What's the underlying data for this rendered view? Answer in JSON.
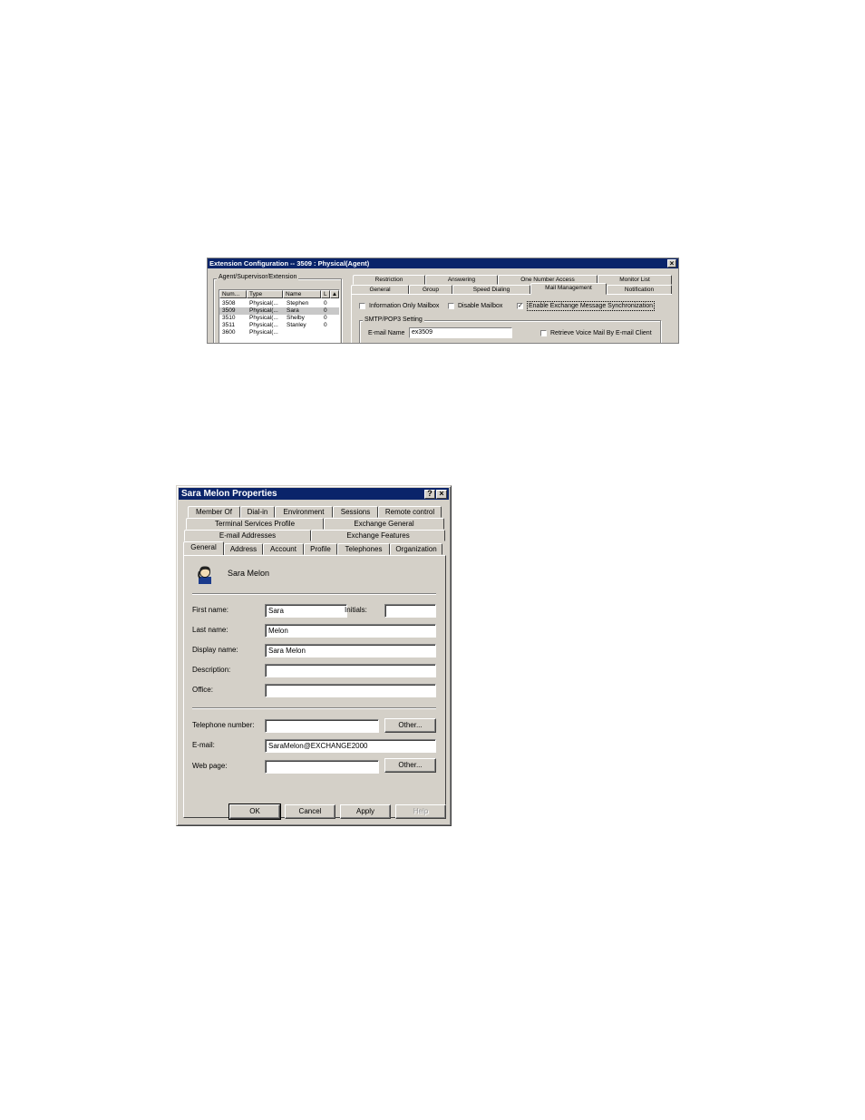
{
  "ext_window": {
    "title": "Extension Configuration -- 3509 : Physical(Agent)",
    "close_glyph": "×",
    "group_label": "Agent/Supervisor/Extension",
    "columns": [
      "Num...",
      "Type",
      "Name",
      "L"
    ],
    "rows": [
      {
        "num": "3508",
        "type": "Physical(...",
        "name": "Stephen",
        "l": "0"
      },
      {
        "num": "3509",
        "type": "Physical(...",
        "name": "Sara",
        "l": "0"
      },
      {
        "num": "3510",
        "type": "Physical(...",
        "name": "Shelby",
        "l": "0"
      },
      {
        "num": "3511",
        "type": "Physical(...",
        "name": "Stanley",
        "l": "0"
      },
      {
        "num": "3600",
        "type": "Physical(...",
        "name": "",
        "l": ""
      }
    ],
    "tabs_back": [
      "Restriction",
      "Answering",
      "One Number Access",
      "Monitor List"
    ],
    "tabs_front": [
      "General",
      "Group",
      "Speed Dialing",
      "Mail Management",
      "Notification"
    ],
    "active_tab": "Mail Management",
    "checkboxes": [
      {
        "label": "Information Only Mailbox",
        "checked": false
      },
      {
        "label": "Disable Mailbox",
        "checked": false
      },
      {
        "label": "Enable Exchange Message Synchronization",
        "checked": true
      }
    ],
    "smtp_group_label": "SMTP/POP3 Setting",
    "email_name_label": "E-mail Name",
    "email_name_value": "ex3509",
    "retrieve_label": "Retrieve Voice Mail By E-mail Client",
    "retrieve_checked": false
  },
  "props_window": {
    "title": "Sara Melon Properties",
    "help_glyph": "?",
    "close_glyph": "×",
    "tabs_row1": [
      "Member Of",
      "Dial-in",
      "Environment",
      "Sessions",
      "Remote control"
    ],
    "tabs_row2": [
      "Terminal Services Profile",
      "Exchange General"
    ],
    "tabs_row3": [
      "E-mail Addresses",
      "Exchange Features"
    ],
    "tabs_row4": [
      "General",
      "Address",
      "Account",
      "Profile",
      "Telephones",
      "Organization"
    ],
    "active_tab": "General",
    "user_display": "Sara Melon",
    "first_name_label": "First name:",
    "first_name_value": "Sara",
    "initials_label": "Initials:",
    "initials_value": "",
    "last_name_label": "Last name:",
    "last_name_value": "Melon",
    "display_name_label": "Display name:",
    "display_name_value": "Sara Melon",
    "description_label": "Description:",
    "description_value": "",
    "office_label": "Office:",
    "office_value": "",
    "telephone_label": "Telephone number:",
    "telephone_value": "",
    "other_label": "Other...",
    "email_label": "E-mail:",
    "email_value": "SaraMelon@EXCHANGE2000",
    "webpage_label": "Web page:",
    "webpage_value": "",
    "buttons": {
      "ok": "OK",
      "cancel": "Cancel",
      "apply": "Apply",
      "help": "Help"
    }
  }
}
